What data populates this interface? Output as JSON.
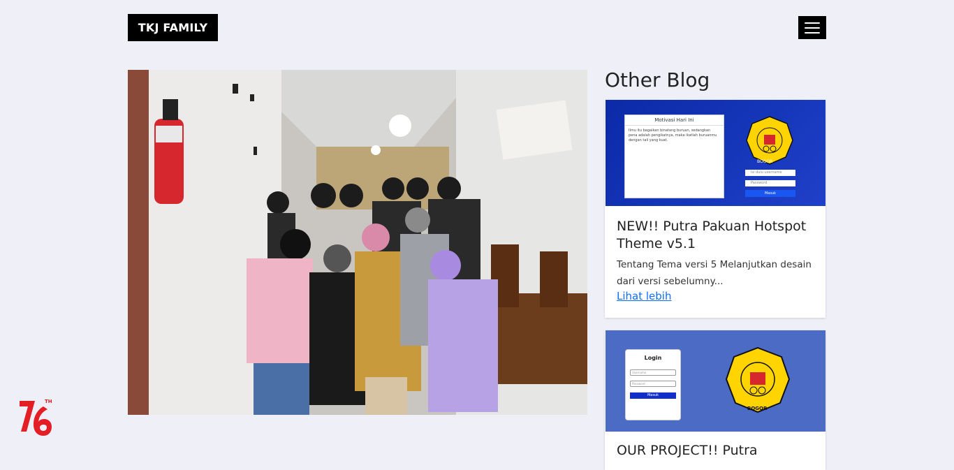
{
  "header": {
    "brand": "TKJ FAMILY",
    "menu_icon": "hamburger-icon"
  },
  "hero": {
    "image_desc_icon": "group-photo"
  },
  "sidebar": {
    "title": "Other Blog",
    "posts": [
      {
        "title": "NEW!! Putra Pakuan Hotspot Theme v5.1",
        "excerpt": "Tentang Tema versi 5 Melanjutkan desain dari versi sebelumny...",
        "link": "Lihat lebih",
        "thumb": {
          "panel_title": "Motivasi Hari Ini",
          "panel_text": "Ilmu itu bagaikan binatang buruan, sedangkan pena adalah pengikatnya, maka ikatlah buruanmu dengan tali yang kuat.",
          "button": "Masuk",
          "username_placeholder": "Isi dulu username",
          "password_placeholder": "Password",
          "logo_text": "YAYASAN PUTRA PAKUAN",
          "logo_city": "BOGOR"
        }
      },
      {
        "title": "OUR PROJECT!! Putra",
        "thumb": {
          "login_title": "Login",
          "button": "Masuk",
          "username_placeholder": "Username",
          "password_placeholder": "Password",
          "logo_text": "YAYASAN PUTRA PAKUAN",
          "logo_city": "BOGOR"
        }
      }
    ]
  },
  "badge": {
    "number": "76",
    "suffix": "TH"
  },
  "colors": {
    "background": "#efeff8",
    "brand_bg": "#000000",
    "link": "#0d6efd",
    "badge": "#e31e24"
  }
}
